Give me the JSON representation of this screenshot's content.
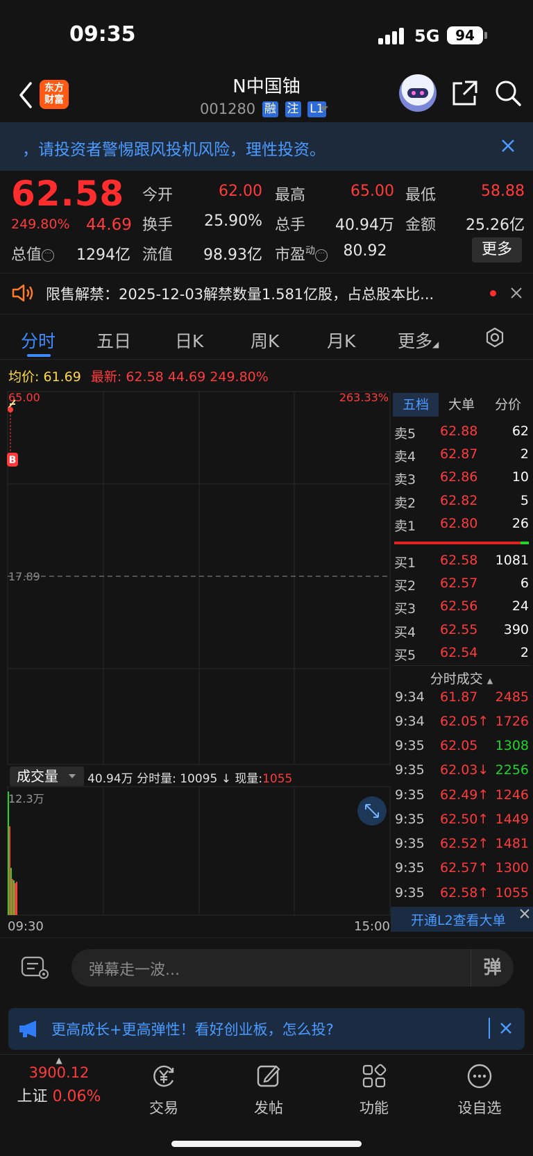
{
  "status": {
    "time": "09:35",
    "network": "5G",
    "battery": "94"
  },
  "header": {
    "logo_line1": "东方",
    "logo_line2": "财富",
    "stock_name": "N中国铀",
    "stock_code": "001280",
    "tags": [
      "融",
      "注",
      "L1"
    ]
  },
  "risk_banner": {
    "text": "，请投资者警惕跟风投机风险，理性投资。"
  },
  "quote": {
    "price": "62.58",
    "change_pct": "249.80%",
    "change": "44.69",
    "open_label": "今开",
    "open": "62.00",
    "high_label": "最高",
    "high": "65.00",
    "low_label": "最低",
    "low": "58.88",
    "turnover_label": "换手",
    "turnover": "25.90%",
    "volume_label": "总手",
    "volume": "40.94万",
    "amount_label": "金额",
    "amount": "25.26亿",
    "mktcap_label": "总值",
    "mktcap": "1294亿",
    "float_label": "流值",
    "float": "98.93亿",
    "pe_label": "市盈",
    "pe_sup": "动",
    "pe": "80.92",
    "more_label": "更多"
  },
  "notice": {
    "text": "限售解禁：2025-12-03解禁数量1.581亿股，占总股本比..."
  },
  "tabs": [
    "分时",
    "五日",
    "日K",
    "周K",
    "月K",
    "更多"
  ],
  "info_line": {
    "avg_label": "均价:",
    "avg": "61.69",
    "last_label": "最新:",
    "last": "62.58",
    "chg": "44.69",
    "pct": "249.80%"
  },
  "chart": {
    "top_price": "65.00",
    "top_pct": "263.33%",
    "mid_price": "17.89",
    "time_start": "09:30",
    "time_end": "15:00",
    "vol_label": "成交量",
    "vol_max": "12.3万",
    "vol_total": "40.94万",
    "minute_vol_label": "分时量:",
    "minute_vol": "10095",
    "minute_vol_arrow": "↓",
    "current_vol_label": "现量:",
    "current_vol": "1055",
    "b_marker": "B"
  },
  "orderbook": {
    "tabs": [
      "五档",
      "大单",
      "分价"
    ],
    "asks": [
      {
        "label": "卖5",
        "price": "62.88",
        "vol": "62"
      },
      {
        "label": "卖4",
        "price": "62.87",
        "vol": "2"
      },
      {
        "label": "卖3",
        "price": "62.86",
        "vol": "10"
      },
      {
        "label": "卖2",
        "price": "62.82",
        "vol": "5"
      },
      {
        "label": "卖1",
        "price": "62.80",
        "vol": "26"
      }
    ],
    "bids": [
      {
        "label": "买1",
        "price": "62.58",
        "vol": "1081"
      },
      {
        "label": "买2",
        "price": "62.57",
        "vol": "6"
      },
      {
        "label": "买3",
        "price": "62.56",
        "vol": "24"
      },
      {
        "label": "买4",
        "price": "62.55",
        "vol": "390"
      },
      {
        "label": "买5",
        "price": "62.54",
        "vol": "2"
      }
    ],
    "ticks_title": "分时成交",
    "ticks": [
      {
        "time": "9:34",
        "price": "61.87",
        "vol": "2485",
        "vcolor": "#ff3b3b",
        "pcolor": "#ff3b3b"
      },
      {
        "time": "9:34",
        "price": "62.05↑",
        "vol": "1726",
        "vcolor": "#ff3b3b",
        "pcolor": "#ff3b3b"
      },
      {
        "time": "9:35",
        "price": "62.05",
        "vol": "1308",
        "vcolor": "#21d32b",
        "pcolor": "#ff3b3b"
      },
      {
        "time": "9:35",
        "price": "62.03↓",
        "vol": "2256",
        "vcolor": "#21d32b",
        "pcolor": "#ff3b3b"
      },
      {
        "time": "9:35",
        "price": "62.49↑",
        "vol": "1246",
        "vcolor": "#ff3b3b",
        "pcolor": "#ff3b3b"
      },
      {
        "time": "9:35",
        "price": "62.50↑",
        "vol": "1449",
        "vcolor": "#ff3b3b",
        "pcolor": "#ff3b3b"
      },
      {
        "time": "9:35",
        "price": "62.52↑",
        "vol": "1481",
        "vcolor": "#ff3b3b",
        "pcolor": "#ff3b3b"
      },
      {
        "time": "9:35",
        "price": "62.57↑",
        "vol": "1300",
        "vcolor": "#ff3b3b",
        "pcolor": "#ff3b3b"
      },
      {
        "time": "9:35",
        "price": "62.58↑",
        "vol": "1055",
        "vcolor": "#ff3b3b",
        "pcolor": "#ff3b3b"
      }
    ],
    "l2_text": "开通L2查看大单"
  },
  "danmu": {
    "placeholder": "弹幕走一波...",
    "send_label": "弹"
  },
  "promo": {
    "text": "更高成长+更高弹性！看好创业板，怎么投?"
  },
  "bottom_nav": {
    "index_value": "3900.12",
    "index_name": "上证",
    "index_pct": "0.06%",
    "items": [
      "交易",
      "发帖",
      "功能",
      "设自选"
    ]
  },
  "colors": {
    "up": "#ff3b3b",
    "down": "#21d32b",
    "accent": "#3d8bff",
    "bg": "#141414"
  }
}
